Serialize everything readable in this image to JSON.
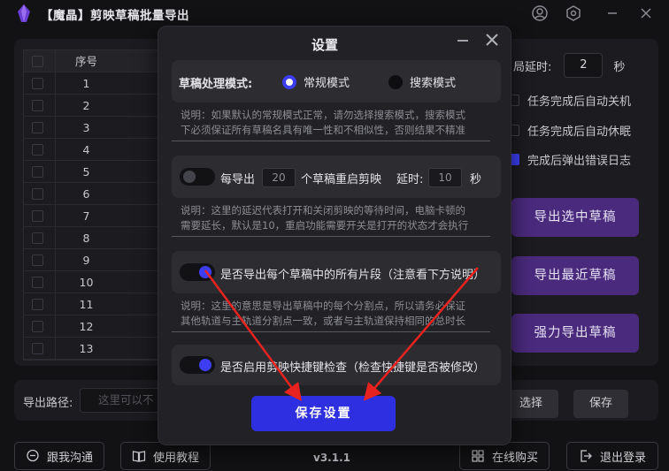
{
  "app": {
    "title": "【魔晶】剪映草稿批量导出",
    "version": "v3.1.1"
  },
  "table": {
    "header_index": "序号",
    "rows": [
      "1",
      "2",
      "3",
      "4",
      "5",
      "6",
      "7",
      "8",
      "9",
      "10",
      "11",
      "12",
      "13"
    ]
  },
  "settings_panel": {
    "delay_label": "局延时:",
    "delay_value": "2",
    "delay_unit": "秒",
    "options": [
      {
        "label": "任务完成后自动关机",
        "checked": false
      },
      {
        "label": "任务完成后自动休眠",
        "checked": false
      },
      {
        "label": "完成后弹出错误日志",
        "checked": true
      }
    ],
    "buttons": [
      "导出选中草稿",
      "导出最近草稿",
      "强力导出草稿"
    ]
  },
  "path_bar": {
    "label": "导出路径:",
    "placeholder": "这里可以不",
    "choose": "选择",
    "save": "保存"
  },
  "footer": {
    "contact": "跟我沟通",
    "tutorial": "使用教程",
    "buy": "在线购买",
    "logout": "退出登录"
  },
  "modal": {
    "title": "设置",
    "mode_label": "草稿处理模式:",
    "mode_options": [
      "常规模式",
      "搜索模式"
    ],
    "mode_selected": "常规模式",
    "mode_note": [
      "说明：如果默认的常规模式正常，请勿选择搜索模式，搜索模式",
      "下必须保证所有草稿名具有唯一性和不相似性，否则结果不精准"
    ],
    "restart": {
      "enabled": false,
      "prefix": "每导出",
      "count": "20",
      "suffix": "个草稿重启剪映",
      "delay_label": "延时:",
      "delay_value": "10",
      "delay_unit": "秒"
    },
    "restart_note": [
      "说明：这里的延迟代表打开和关闭剪映的等待时间，电脑卡顿的",
      "需要延长，默认是10，重启功能需要开关是打开的状态才会执行"
    ],
    "all_segments": {
      "enabled": true,
      "label": "是否导出每个草稿中的所有片段（注意看下方说明）"
    },
    "segments_note": [
      "说明：这里的意思是导出草稿中的每个分割点，所以请务必保证",
      "其他轨道与主轨道分割点一致，或者与主轨道保持相同的总时长"
    ],
    "shortcut_check": {
      "enabled": true,
      "label": "是否启用剪映快捷键检查（检查快捷键是否被修改）"
    },
    "save_button": "保存设置"
  },
  "colors": {
    "accent": "#3d3df5",
    "save_button": "#2f2fe2",
    "export_button": "#4a2a7c",
    "arrow": "#e8231f"
  }
}
